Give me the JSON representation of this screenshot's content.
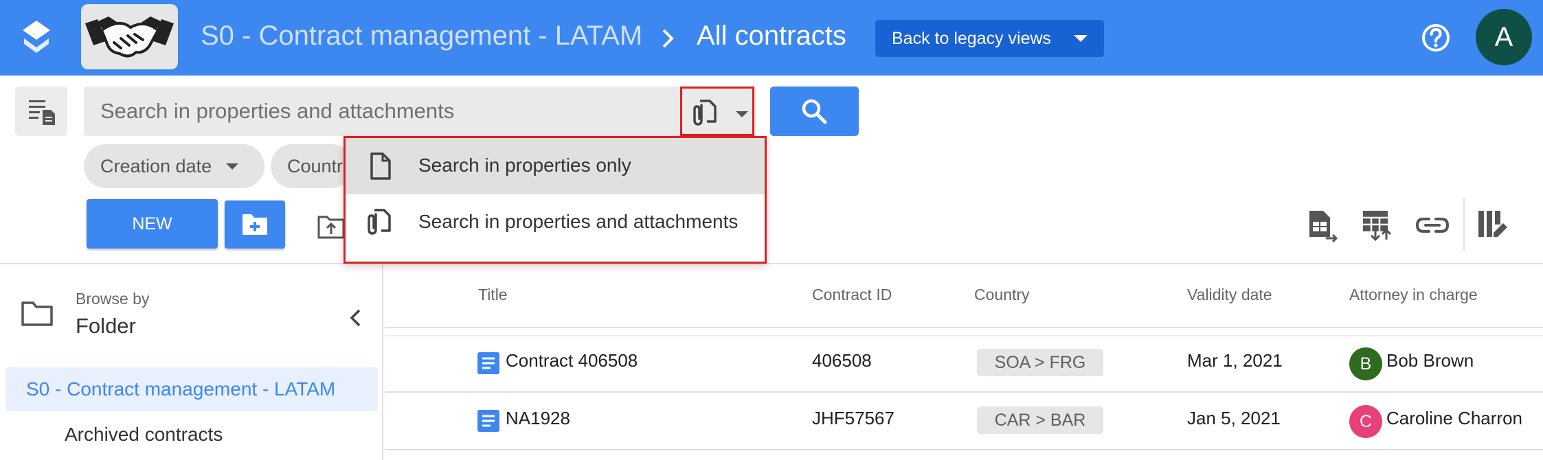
{
  "header": {
    "breadcrumb_root": "S0 - Contract management - LATAM",
    "breadcrumb_current": "All contracts",
    "legacy_button": "Back to legacy views",
    "avatar_initial": "A",
    "brand_color": "#3d87f0"
  },
  "search": {
    "placeholder": "Search in properties and attachments",
    "mode_menu": {
      "items": [
        {
          "label": "Search in properties only",
          "icon": "document-icon",
          "selected": true
        },
        {
          "label": "Search in properties and attachments",
          "icon": "attachment-document-icon",
          "selected": false
        }
      ]
    }
  },
  "filters": {
    "creation_date": "Creation date",
    "country": "Countr"
  },
  "actions": {
    "new_label": "NEW"
  },
  "sidebar": {
    "browse_by_label": "Browse by",
    "browse_by_value": "Folder",
    "items": [
      {
        "label": "S0 - Contract management - LATAM",
        "active": true
      },
      {
        "label": "Archived contracts",
        "active": false
      }
    ]
  },
  "table": {
    "columns": [
      "Title",
      "Contract ID",
      "Country",
      "Validity date",
      "Attorney in charge"
    ],
    "rows": [
      {
        "title": "Contract 406508",
        "contract_id": "406508",
        "country": "SOA  >  FRG",
        "validity": "Mar 1, 2021",
        "attorney": "Bob Brown",
        "attorney_initial": "B",
        "attorney_color": "#2e6b1e"
      },
      {
        "title": "NA1928",
        "contract_id": "JHF57567",
        "country": "CAR  >  BAR",
        "validity": "Jan 5, 2021",
        "attorney": "Caroline Charron",
        "attorney_initial": "C",
        "attorney_color": "#e8417a"
      }
    ]
  }
}
